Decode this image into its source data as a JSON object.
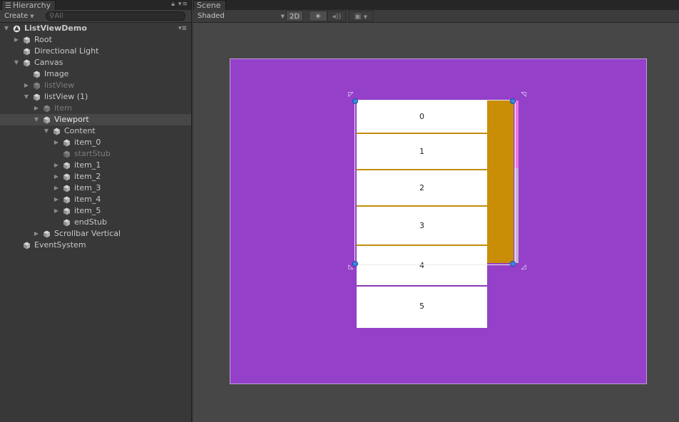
{
  "hierarchy": {
    "tab_label": "Hierarchy",
    "tab_icon": "list-icon",
    "create_label": "Create",
    "search_placeholder": "All",
    "scene_name": "ListViewDemo",
    "items": [
      {
        "label": "Root",
        "depth": 1,
        "fold": "collapsed",
        "dim": false,
        "selected": false
      },
      {
        "label": "Directional Light",
        "depth": 1,
        "fold": "none",
        "dim": false,
        "selected": false
      },
      {
        "label": "Canvas",
        "depth": 1,
        "fold": "expanded",
        "dim": false,
        "selected": false
      },
      {
        "label": "Image",
        "depth": 2,
        "fold": "none",
        "dim": false,
        "selected": false
      },
      {
        "label": "listView",
        "depth": 2,
        "fold": "collapsed",
        "dim": true,
        "selected": false
      },
      {
        "label": "listView (1)",
        "depth": 2,
        "fold": "expanded",
        "dim": false,
        "selected": false
      },
      {
        "label": "item",
        "depth": 3,
        "fold": "collapsed",
        "dim": true,
        "selected": false
      },
      {
        "label": "Viewport",
        "depth": 3,
        "fold": "expanded",
        "dim": false,
        "selected": true
      },
      {
        "label": "Content",
        "depth": 4,
        "fold": "expanded",
        "dim": false,
        "selected": false
      },
      {
        "label": "item_0",
        "depth": 5,
        "fold": "collapsed",
        "dim": false,
        "selected": false
      },
      {
        "label": "startStub",
        "depth": 5,
        "fold": "none",
        "dim": true,
        "selected": false
      },
      {
        "label": "item_1",
        "depth": 5,
        "fold": "collapsed",
        "dim": false,
        "selected": false
      },
      {
        "label": "item_2",
        "depth": 5,
        "fold": "collapsed",
        "dim": false,
        "selected": false
      },
      {
        "label": "item_3",
        "depth": 5,
        "fold": "collapsed",
        "dim": false,
        "selected": false
      },
      {
        "label": "item_4",
        "depth": 5,
        "fold": "collapsed",
        "dim": false,
        "selected": false
      },
      {
        "label": "item_5",
        "depth": 5,
        "fold": "collapsed",
        "dim": false,
        "selected": false
      },
      {
        "label": "endStub",
        "depth": 5,
        "fold": "none",
        "dim": false,
        "selected": false
      },
      {
        "label": "Scrollbar Vertical",
        "depth": 3,
        "fold": "collapsed",
        "dim": false,
        "selected": false
      },
      {
        "label": "EventSystem",
        "depth": 1,
        "fold": "none",
        "dim": false,
        "selected": false
      }
    ]
  },
  "scene": {
    "tab_label": "Scene",
    "shading_mode": "Shaded",
    "mode_2d_label": "2D",
    "lighting_icon": "sun-icon",
    "audio_icon": "speaker-icon",
    "effects_icon": "image-icon",
    "list_items": [
      "0",
      "1",
      "2",
      "3",
      "4",
      "5"
    ],
    "colors": {
      "canvas": "#9440c9",
      "scrollbar": "#c98e06",
      "scroll_handle": "#e87adf",
      "separator": "#c38d0c",
      "handle": "#3b86e3"
    }
  }
}
